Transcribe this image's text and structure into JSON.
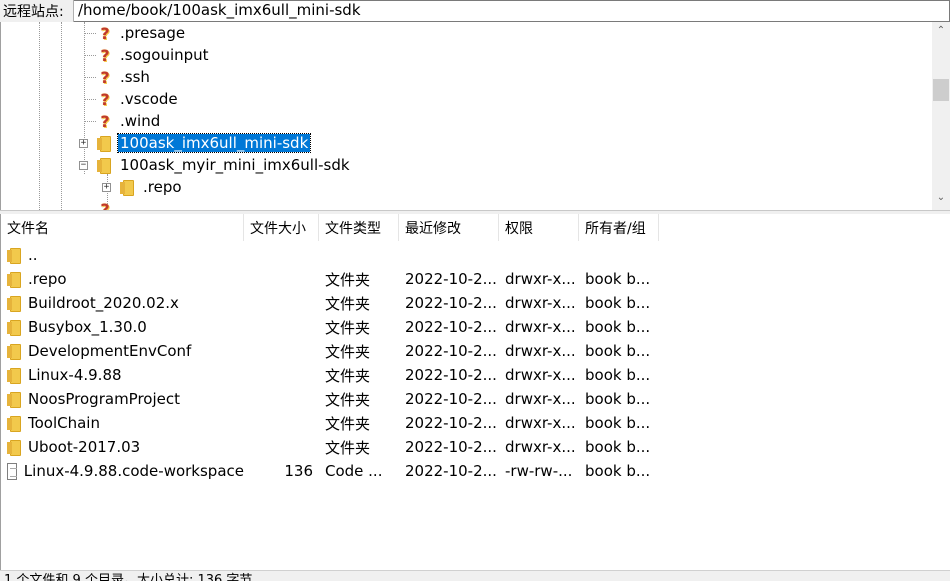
{
  "site_bar": {
    "label": "远程站点:",
    "path": "/home/book/100ask_imx6ull_mini-sdk"
  },
  "tree": {
    "items": [
      {
        "label": ".presage",
        "icon": "question-icon"
      },
      {
        "label": ".sogouinput",
        "icon": "question-icon"
      },
      {
        "label": ".ssh",
        "icon": "question-icon"
      },
      {
        "label": ".vscode",
        "icon": "question-icon"
      },
      {
        "label": ".wind",
        "icon": "question-icon"
      },
      {
        "label": "100ask_imx6ull_mini-sdk",
        "icon": "folder-icon",
        "selected": true,
        "expander": "+"
      },
      {
        "label": "100ask_myir_mini_imx6ull-sdk",
        "icon": "folder-icon",
        "expander": "−"
      },
      {
        "label": ".repo",
        "icon": "folder-icon",
        "expander": "+"
      }
    ]
  },
  "list": {
    "headers": {
      "name": "文件名",
      "size": "文件大小",
      "type": "文件类型",
      "modified": "最近修改",
      "perm": "权限",
      "owner": "所有者/组"
    },
    "rows": [
      {
        "name": "..",
        "size": "",
        "type": "",
        "modified": "",
        "perm": "",
        "owner": "",
        "icon": "folder-icon"
      },
      {
        "name": ".repo",
        "size": "",
        "type": "文件夹",
        "modified": "2022-10-2...",
        "perm": "drwxr-x...",
        "owner": "book b...",
        "icon": "folder-icon"
      },
      {
        "name": "Buildroot_2020.02.x",
        "size": "",
        "type": "文件夹",
        "modified": "2022-10-2...",
        "perm": "drwxr-x...",
        "owner": "book b...",
        "icon": "folder-icon"
      },
      {
        "name": "Busybox_1.30.0",
        "size": "",
        "type": "文件夹",
        "modified": "2022-10-2...",
        "perm": "drwxr-x...",
        "owner": "book b...",
        "icon": "folder-icon"
      },
      {
        "name": "DevelopmentEnvConf",
        "size": "",
        "type": "文件夹",
        "modified": "2022-10-2...",
        "perm": "drwxr-x...",
        "owner": "book b...",
        "icon": "folder-icon"
      },
      {
        "name": "Linux-4.9.88",
        "size": "",
        "type": "文件夹",
        "modified": "2022-10-2...",
        "perm": "drwxr-x...",
        "owner": "book b...",
        "icon": "folder-icon"
      },
      {
        "name": "NoosProgramProject",
        "size": "",
        "type": "文件夹",
        "modified": "2022-10-2...",
        "perm": "drwxr-x...",
        "owner": "book b...",
        "icon": "folder-icon"
      },
      {
        "name": "ToolChain",
        "size": "",
        "type": "文件夹",
        "modified": "2022-10-2...",
        "perm": "drwxr-x...",
        "owner": "book b...",
        "icon": "folder-icon"
      },
      {
        "name": "Uboot-2017.03",
        "size": "",
        "type": "文件夹",
        "modified": "2022-10-2...",
        "perm": "drwxr-x...",
        "owner": "book b...",
        "icon": "folder-icon"
      },
      {
        "name": "Linux-4.9.88.code-workspace",
        "size": "136",
        "type": "Code ...",
        "modified": "2022-10-2...",
        "perm": "-rw-rw-...",
        "owner": "book b...",
        "icon": "file-icon"
      }
    ]
  },
  "status": {
    "text": "1 个文件和 9 个目录。大小总计: 136 字节"
  },
  "colors": {
    "selection": "#0078d7",
    "folder": "#f2c94c",
    "chrome": "#f0f0f0"
  }
}
